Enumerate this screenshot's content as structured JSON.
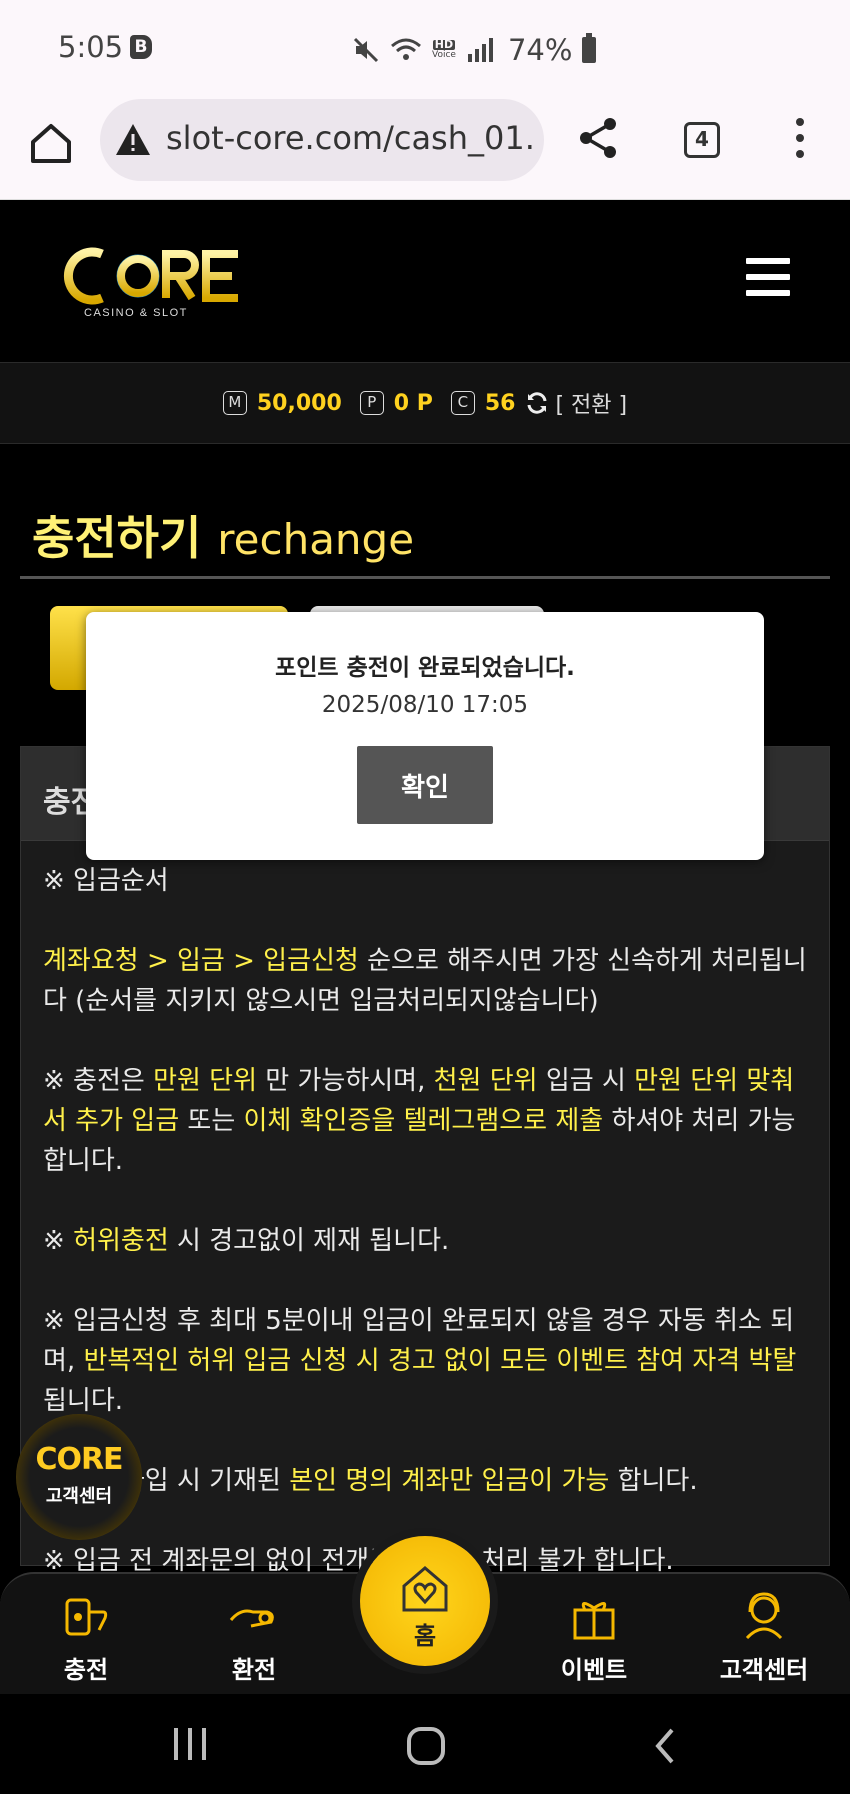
{
  "status_bar": {
    "time": "5:05",
    "badge": "B",
    "hd_label": "HD",
    "voice_label": "Voice",
    "battery": "74%"
  },
  "browser": {
    "url": "slot-core.com/cash_01.",
    "tab_count": "4"
  },
  "site": {
    "logo_text": "CORE",
    "logo_sub": "CASINO & SLOT"
  },
  "balance": {
    "money_icon": "M",
    "money": "50,000",
    "point_icon": "P",
    "point": "0 P",
    "coin_icon": "C",
    "coin": "56",
    "switch_label": "[ 전환 ]"
  },
  "page": {
    "title_ko": "충전하기",
    "title_en": "rechange"
  },
  "panel": {
    "heading": "충전",
    "section_label": "※ 입금순서",
    "p1": {
      "hl": "계좌요청 > 입금 > 입금신청",
      "rest": " 순으로 해주시면 가장 신속하게 처리됩니다 (순서를 지키지 않으시면 입금처리되지않습니다)"
    },
    "p2": {
      "a": "※ 충전은 ",
      "b": "만원 단위",
      "c": " 만 가능하시며, ",
      "d": "천원 단위",
      "e": " 입금 시 ",
      "f": "만원 단위 맞춰서 추가 입금",
      "g": " 또는 ",
      "h": "이체 확인증을 텔레그램으로 제출",
      "i": " 하셔야 처리 가능합니다."
    },
    "p3": {
      "a": "※ ",
      "b": "허위충전",
      "c": " 시 경고없이 제재 됩니다."
    },
    "p4": {
      "a": "※ 입금신청 후 최대 5분이내 입금이 완료되지 않을 경우 자동 취소 되며, ",
      "b": "반복적인 허위 입금 신청 시 경고 없이 모든 이벤트 참여 자격 박탈",
      "c": "됩니다."
    },
    "p5": {
      "a": "※ 회원가입 시 기재된 ",
      "b": "본인 명의 계좌만 입금이 가능",
      "c": " 합니다."
    },
    "p6": "※ 입금 전 계좌문의 없이 전개된 입금은 처리 불가 합니다."
  },
  "fab": {
    "logo": "CORE",
    "label": "고객센터"
  },
  "bottom_nav": {
    "charge": "충전",
    "exchange": "환전",
    "home": "홈",
    "event": "이벤트",
    "support": "고객센터"
  },
  "modal": {
    "message": "포인트 충전이 완료되었습니다.",
    "datetime": "2025/08/10 17:05",
    "confirm": "확인"
  },
  "colors": {
    "accent": "#ffd21f",
    "highlight": "#fff04a",
    "title": "#fff176"
  }
}
